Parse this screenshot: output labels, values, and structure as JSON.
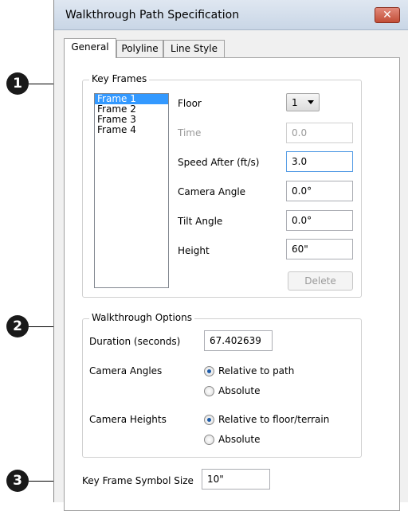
{
  "window": {
    "title": "Walkthrough Path Specification",
    "close_glyph": "✕"
  },
  "tabs": [
    {
      "label": "General",
      "active": true
    },
    {
      "label": "Polyline",
      "active": false
    },
    {
      "label": "Line Style",
      "active": false
    }
  ],
  "key_frames": {
    "label": "Key Frames",
    "frames": [
      "Frame 1",
      "Frame 2",
      "Frame 3",
      "Frame 4"
    ],
    "selected_frame": "Frame 1",
    "floor": {
      "label": "Floor",
      "value": "1"
    },
    "time": {
      "label": "Time",
      "value": "0.0"
    },
    "speed_after": {
      "label": "Speed After (ft/s)",
      "value": "3.0"
    },
    "camera_angle": {
      "label": "Camera Angle",
      "value": "0.0°"
    },
    "tilt_angle": {
      "label": "Tilt Angle",
      "value": "0.0°"
    },
    "height": {
      "label": "Height",
      "value": "60\""
    },
    "delete_label": "Delete"
  },
  "walkthrough_options": {
    "label": "Walkthrough Options",
    "duration": {
      "label": "Duration (seconds)",
      "value": "67.402639"
    },
    "camera_angles": {
      "label": "Camera Angles",
      "options": [
        "Relative to path",
        "Absolute"
      ],
      "selected": "Relative to path"
    },
    "camera_heights": {
      "label": "Camera Heights",
      "options": [
        "Relative to floor/terrain",
        "Absolute"
      ],
      "selected": "Relative to floor/terrain"
    }
  },
  "key_frame_symbol_size": {
    "label": "Key Frame Symbol Size",
    "value": "10\""
  },
  "callouts": [
    "1",
    "2",
    "3"
  ]
}
